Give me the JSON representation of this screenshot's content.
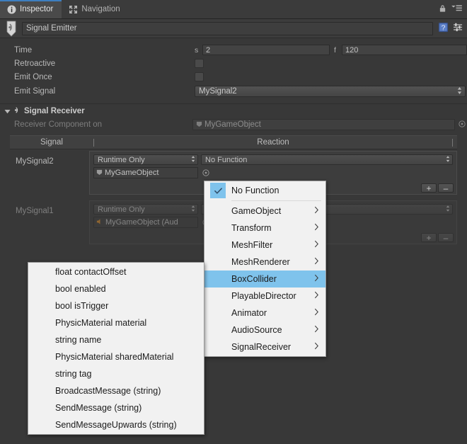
{
  "window": {
    "tabs": [
      {
        "label": "Inspector",
        "icon": "info-icon",
        "active": true
      },
      {
        "label": "Navigation",
        "icon": "navigation-icon",
        "active": false
      }
    ],
    "lock_icon": "lock-icon",
    "menu_icon": "hamburger-menu-icon"
  },
  "header": {
    "marker_icon": "signal-emitter-marker-icon",
    "name_value": "Signal Emitter",
    "help_icon": "help-book-icon",
    "settings_icon": "component-settings-icon"
  },
  "emitter": {
    "time": {
      "label": "Time",
      "seconds_unit": "s",
      "seconds_value": "2",
      "frames_unit": "f",
      "frames_value": "120"
    },
    "retroactive": {
      "label": "Retroactive",
      "checked": false
    },
    "emit_once": {
      "label": "Emit Once",
      "checked": false
    },
    "emit_signal": {
      "label": "Emit Signal",
      "value": "MySignal2"
    }
  },
  "receiver": {
    "title": "Signal Receiver",
    "foldout_expanded": true,
    "component_on": {
      "label": "Receiver Component on",
      "value": "MyGameObject",
      "object_icon": "gameobject-icon",
      "select_icon": "object-picker-icon"
    },
    "columns": {
      "signal": "Signal",
      "reaction": "Reaction"
    },
    "events": [
      {
        "signal": "MySignal2",
        "mode": "Runtime Only",
        "target": "MyGameObject",
        "target_icon": "gameobject-icon",
        "function": "No Function",
        "add_label": "+",
        "remove_label": "–",
        "dimmed": false
      },
      {
        "signal": "MySignal1",
        "mode": "Runtime Only",
        "target": "MyGameObject (Aud",
        "target_icon": "audiosource-icon",
        "function": "",
        "add_label": "+",
        "remove_label": "–",
        "dimmed": true
      }
    ]
  },
  "function_menu": {
    "checked_item": "No Function",
    "highlighted_item": "BoxCollider",
    "items": [
      {
        "label": "No Function",
        "checked": true,
        "submenu": false
      },
      {
        "label": "GameObject",
        "checked": false,
        "submenu": true
      },
      {
        "label": "Transform",
        "checked": false,
        "submenu": true
      },
      {
        "label": "MeshFilter",
        "checked": false,
        "submenu": true
      },
      {
        "label": "MeshRenderer",
        "checked": false,
        "submenu": true
      },
      {
        "label": "BoxCollider",
        "checked": false,
        "submenu": true,
        "selected": true
      },
      {
        "label": "PlayableDirector",
        "checked": false,
        "submenu": true
      },
      {
        "label": "Animator",
        "checked": false,
        "submenu": true
      },
      {
        "label": "AudioSource",
        "checked": false,
        "submenu": true
      },
      {
        "label": "SignalReceiver",
        "checked": false,
        "submenu": true
      }
    ]
  },
  "submenu": {
    "items": [
      {
        "label": "float contactOffset"
      },
      {
        "label": "bool enabled"
      },
      {
        "label": "bool isTrigger"
      },
      {
        "label": "PhysicMaterial material"
      },
      {
        "label": "string name"
      },
      {
        "label": "PhysicMaterial sharedMaterial"
      },
      {
        "label": "string tag"
      },
      {
        "label": "BroadcastMessage (string)"
      },
      {
        "label": "SendMessage (string)"
      },
      {
        "label": "SendMessageUpwards (string)"
      }
    ]
  },
  "colors": {
    "panel_bg": "#383838",
    "tab_active_bg": "#4a4a4a",
    "tab_accent": "#3d7ec0",
    "menu_bg": "#f1f1f1",
    "menu_highlight": "#7fc3ec",
    "text": "#b9b9b9"
  }
}
